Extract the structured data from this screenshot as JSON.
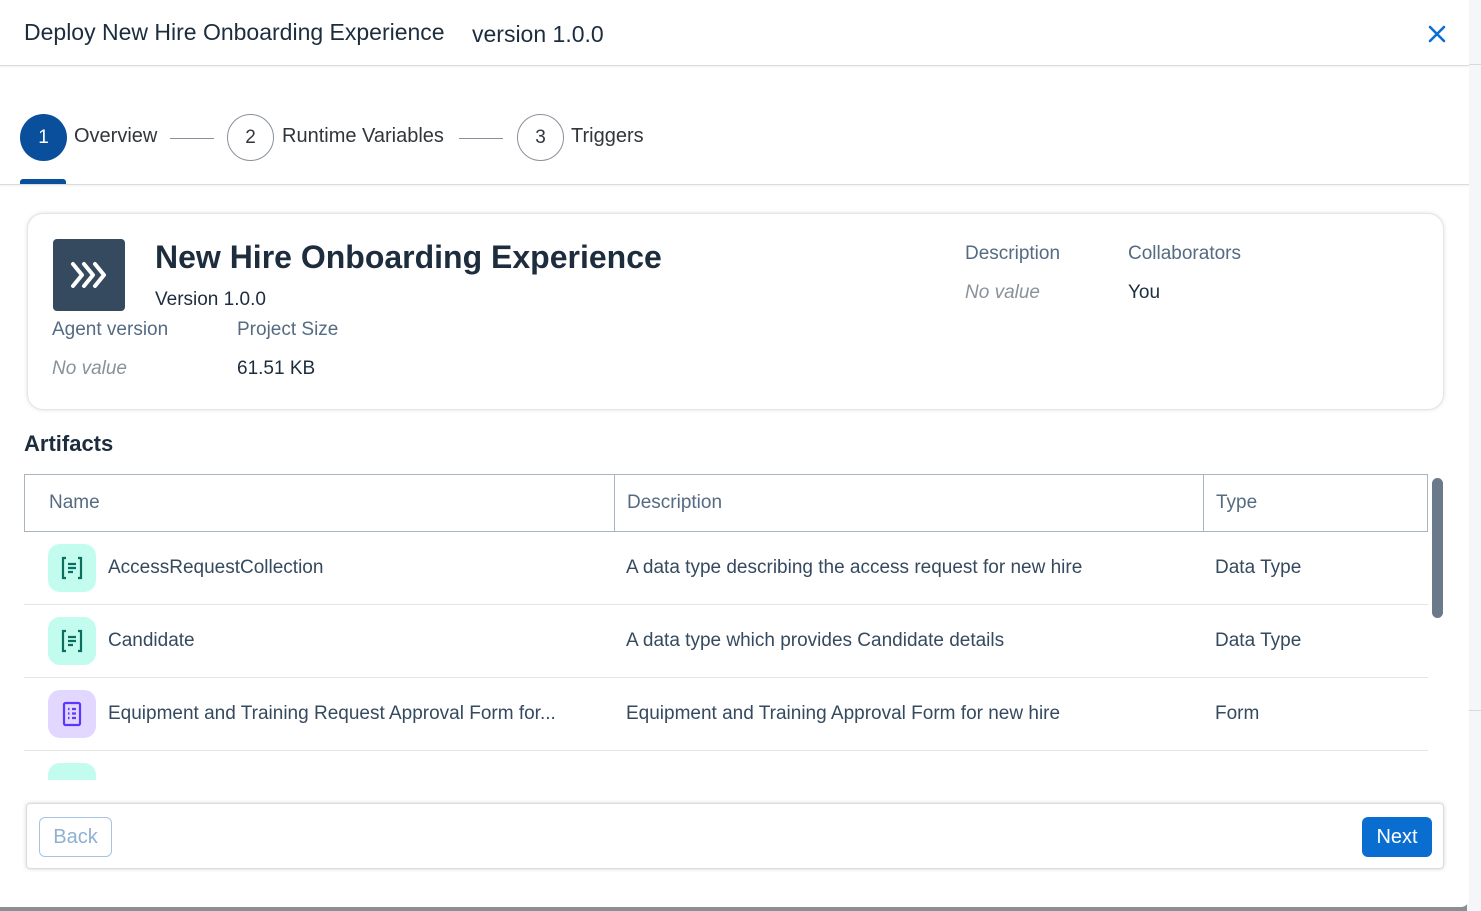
{
  "dialog": {
    "title": "Deploy New Hire Onboarding Experience",
    "version": "version 1.0.0"
  },
  "wizard": {
    "steps": [
      {
        "number": "1",
        "label": "Overview",
        "state": "active"
      },
      {
        "number": "2",
        "label": "Runtime Variables",
        "state": "inactive"
      },
      {
        "number": "3",
        "label": "Triggers",
        "state": "inactive"
      }
    ]
  },
  "project": {
    "icon": "chevrons-right-icon",
    "name": "New Hire Onboarding Experience",
    "version": "Version 1.0.0",
    "agent_version_label": "Agent version",
    "agent_version_value": "No value",
    "project_size_label": "Project Size",
    "project_size_value": "61.51 KB",
    "description_label": "Description",
    "description_value": "No value",
    "collaborators_label": "Collaborators",
    "collaborators_value": "You"
  },
  "artifacts": {
    "title": "Artifacts",
    "columns": [
      "Name",
      "Description",
      "Type"
    ],
    "rows": [
      {
        "icon": "data-type-icon",
        "icon_color": "teal",
        "name": "AccessRequestCollection",
        "description": "A data type describing the access request for new hire",
        "type": "Data Type"
      },
      {
        "icon": "data-type-icon",
        "icon_color": "teal",
        "name": "Candidate",
        "description": "A data type which provides Candidate details",
        "type": "Data Type"
      },
      {
        "icon": "form-icon",
        "icon_color": "purple",
        "name": "Equipment and Training Request Approval Form for...",
        "description": "Equipment and Training Approval Form for new hire",
        "type": "Form"
      }
    ]
  },
  "footer": {
    "back_label": "Back",
    "next_label": "Next"
  },
  "colors": {
    "accent": "#0a6ed1",
    "step_active": "#0a4f9c",
    "project_icon_bg": "#354a5f",
    "teal_icon_bg": "#c2fcee",
    "purple_icon_bg": "#e2d8ff"
  }
}
